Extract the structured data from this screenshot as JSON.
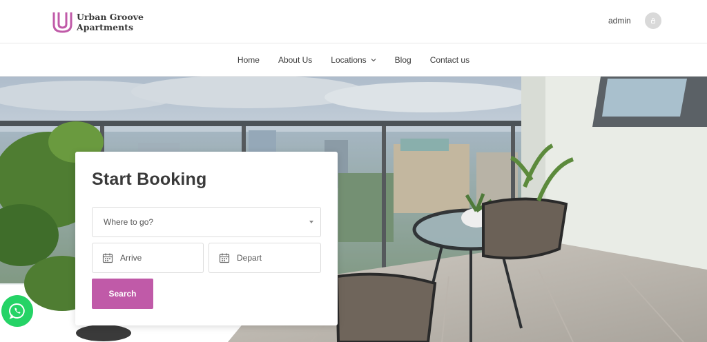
{
  "brand": {
    "name_line1": "Urban Groove",
    "name_line2": "Apartments",
    "accent": "#c05aa8"
  },
  "header": {
    "user_label": "admin",
    "avatar_icon": "user-icon"
  },
  "nav": {
    "items": [
      {
        "label": "Home"
      },
      {
        "label": "About Us"
      },
      {
        "label": "Locations",
        "icon": "chevron-down-icon"
      },
      {
        "label": "Blog"
      },
      {
        "label": "Contact us"
      }
    ]
  },
  "booking": {
    "title": "Start Booking",
    "where_placeholder": "Where to go?",
    "arrive_placeholder": "Arrive",
    "depart_placeholder": "Depart",
    "search_label": "Search",
    "calendar_icon": "calendar-icon"
  },
  "floating": {
    "whatsapp_icon": "whatsapp-icon",
    "whatsapp_color": "#25d366"
  }
}
